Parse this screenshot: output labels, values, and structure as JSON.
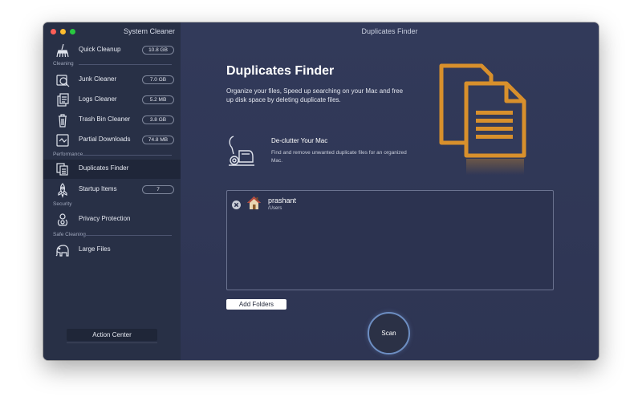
{
  "window": {
    "sidebar_title": "System Cleaner",
    "title": "Duplicates Finder"
  },
  "sidebar": {
    "quick_cleanup": {
      "label": "Quick Cleanup",
      "badge": "10.8 GB",
      "icon": "broom-icon"
    },
    "sections": {
      "cleaning": "Cleaning",
      "performance": "Performance",
      "security": "Security",
      "safe_cleaning": "Safe Cleaning"
    },
    "items": [
      {
        "label": "Junk Cleaner",
        "badge": "7.0 GB",
        "icon": "junk-search-icon"
      },
      {
        "label": "Logs Cleaner",
        "badge": "5.2 MB",
        "icon": "logs-icon"
      },
      {
        "label": "Trash Bin Cleaner",
        "badge": "3.8 GB",
        "icon": "trash-icon"
      },
      {
        "label": "Partial Downloads",
        "badge": "74.8 MB",
        "icon": "partial-download-icon"
      },
      {
        "label": "Duplicates Finder",
        "badge": "",
        "icon": "duplicates-icon",
        "active": true
      },
      {
        "label": "Startup Items",
        "badge": "7",
        "icon": "rocket-icon"
      },
      {
        "label": "Privacy Protection",
        "badge": "",
        "icon": "privacy-icon"
      },
      {
        "label": "Large Files",
        "badge": "",
        "icon": "elephant-icon"
      }
    ],
    "action_center": "Action Center"
  },
  "main": {
    "heading": "Duplicates Finder",
    "subtitle": "Organize your files, Speed up searching on your Mac and free up disk space by deleting duplicate files.",
    "feature": {
      "title": "De-clutter Your Mac",
      "description": "Find and remove unwanted duplicate files for an organized Mac."
    },
    "folders": [
      {
        "name": "prashant",
        "path": "/Users"
      }
    ],
    "add_folders": "Add Folders",
    "scan": "Scan"
  },
  "colors": {
    "accent": "#d8902c",
    "sidebar_bg": "#283046",
    "main_bg": "#323a5a",
    "scan_ring": "#6d8ec2"
  }
}
